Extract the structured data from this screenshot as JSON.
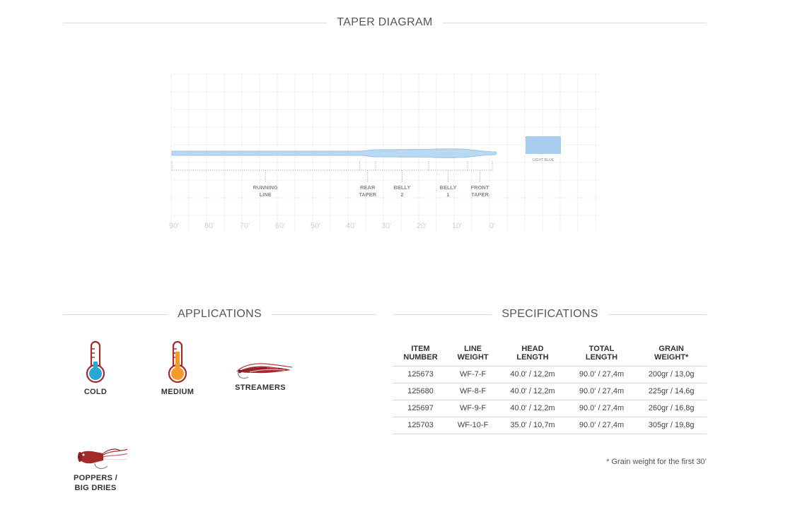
{
  "taper": {
    "title": "TAPER DIAGRAM",
    "color_swatch": {
      "label": "LIGHT BLUE",
      "color": "#a9cdee"
    },
    "sections": [
      {
        "name": "running-line",
        "lines": [
          "RUNNING",
          "LINE"
        ],
        "start": 90,
        "end": 37.5
      },
      {
        "name": "rear-taper",
        "lines": [
          "REAR",
          "TAPER"
        ],
        "start": 37.5,
        "end": 33
      },
      {
        "name": "belly-2",
        "lines": [
          "BELLY",
          "2"
        ],
        "start": 33,
        "end": 18
      },
      {
        "name": "belly-1",
        "lines": [
          "BELLY",
          "1"
        ],
        "start": 18,
        "end": 7
      },
      {
        "name": "front-taper",
        "lines": [
          "FRONT",
          "TAPER"
        ],
        "start": 7,
        "end": 0
      }
    ],
    "axis_ticks": [
      "90'",
      "80'",
      "70'",
      "60'",
      "50'",
      "40'",
      "30'",
      "20'",
      "10'",
      "0'"
    ],
    "tick_values": [
      90,
      80,
      70,
      60,
      50,
      40,
      30,
      20,
      10,
      0
    ],
    "line_color": "#b9d8f2",
    "line_edge_color": "#9cc3e6"
  },
  "applications": {
    "title": "APPLICATIONS",
    "items": [
      {
        "name": "cold",
        "label": "COLD",
        "icon": "cold-thermometer-icon",
        "fill": "#27a9d3"
      },
      {
        "name": "medium",
        "label": "MEDIUM",
        "icon": "medium-thermometer-icon",
        "fill": "#f39a2b"
      },
      {
        "name": "streamers",
        "label": "STREAMERS",
        "icon": "streamer-fly-icon"
      },
      {
        "name": "poppers",
        "label_lines": [
          "POPPERS /",
          "BIG DRIES"
        ],
        "icon": "popper-fly-icon"
      }
    ],
    "accent": "#a32a2a"
  },
  "specifications": {
    "title": "SPECIFICATIONS",
    "headers": [
      [
        "ITEM",
        "NUMBER"
      ],
      [
        "LINE",
        "WEIGHT"
      ],
      [
        "HEAD",
        "LENGTH"
      ],
      [
        "TOTAL",
        "LENGTH"
      ],
      [
        "GRAIN",
        "WEIGHT*"
      ]
    ],
    "rows": [
      [
        "125673",
        "WF-7-F",
        "40.0' / 12,2m",
        "90.0' / 27,4m",
        "200gr / 13,0g"
      ],
      [
        "125680",
        "WF-8-F",
        "40.0' / 12,2m",
        "90.0' / 27,4m",
        "225gr / 14,6g"
      ],
      [
        "125697",
        "WF-9-F",
        "40.0' / 12,2m",
        "90.0' / 27,4m",
        "260gr / 16,8g"
      ],
      [
        "125703",
        "WF-10-F",
        "35.0' / 10,7m",
        "90.0' / 27,4m",
        "305gr / 19,8g"
      ]
    ],
    "footnote": "* Grain weight for the first 30’"
  }
}
